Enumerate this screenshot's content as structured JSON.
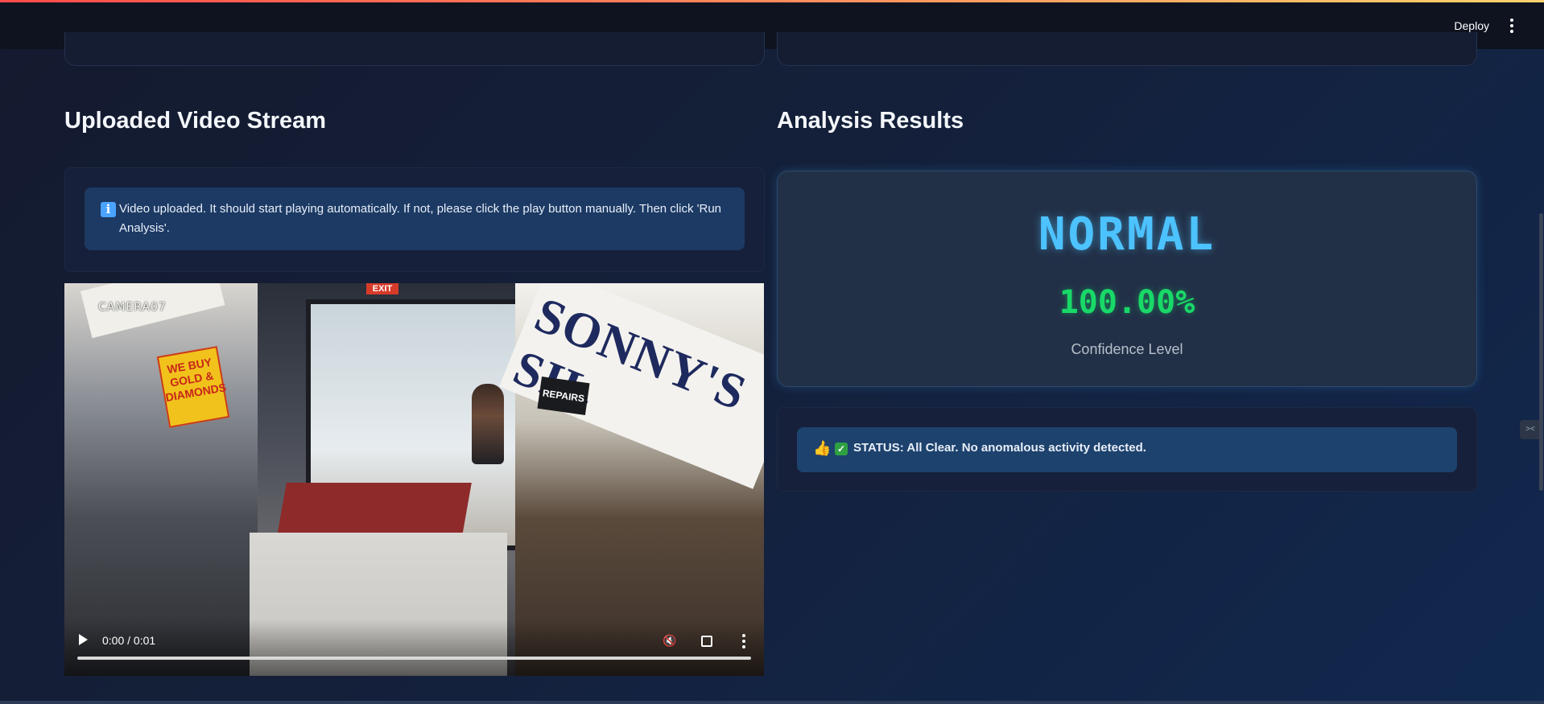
{
  "header": {
    "deploy_label": "Deploy",
    "menu_icon": "kebab-menu-icon"
  },
  "left": {
    "title": "Uploaded Video Stream",
    "info_icon": "info-icon",
    "info_message": "Video uploaded. It should start playing automatically. If not, please click the play button manually. Then click 'Run Analysis'.",
    "video": {
      "overlay_camera": "CAMERA07",
      "sign_left": "WE BUY GOLD & DIAMONDS",
      "sign_right": "SONNY'S SIL",
      "sign_repairs": "REPAIRS",
      "sign_exit": "EXIT",
      "time": "0:00 / 0:01",
      "progress": 0.0
    }
  },
  "right": {
    "title": "Analysis Results",
    "classification": "NORMAL",
    "confidence_value": "100.00%",
    "confidence_label": "Confidence Level",
    "status_icon_1": "thumbs-up-icon",
    "status_icon_2": "check-icon",
    "status_text": "STATUS: All Clear. No anomalous activity detected."
  },
  "colors": {
    "classification": "#4cc2ff",
    "confidence": "#18d968",
    "info_bg": "#1c3a64",
    "status_bg": "#1d426d"
  }
}
